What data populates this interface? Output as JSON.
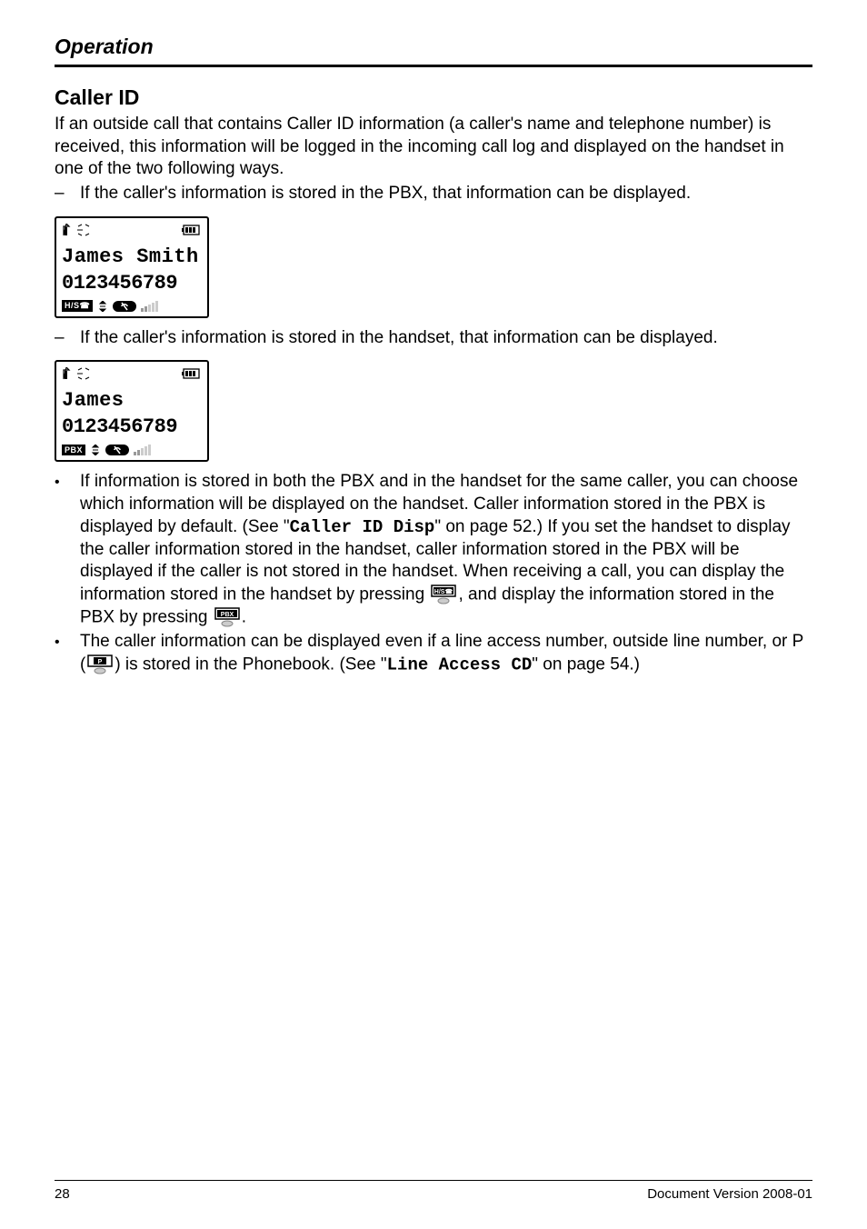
{
  "header": "Operation",
  "section_title": "Caller ID",
  "intro": "If an outside call that contains Caller ID information (a caller's name and telephone number) is received, this information will be logged in the incoming call log and displayed on the handset in one of the two following ways.",
  "dash1": "If the caller's information is stored in the PBX, that information can be displayed.",
  "display1": {
    "name": "James Smith",
    "number": "0123456789",
    "badge": "H/S"
  },
  "dash2": "If the caller's information is stored in the handset, that information can be displayed.",
  "display2": {
    "name": "James",
    "number": "0123456789",
    "badge": "PBX"
  },
  "bullet1_a": "If information is stored in both the PBX and in the handset for the same caller, you can choose which information will be displayed on the handset. Caller information stored in the PBX is displayed by default. (See \"",
  "bullet1_code1": "Caller ID Disp",
  "bullet1_b": "\" on page 52.) If you set the handset to display the caller information stored in the handset, caller information stored in the PBX will be displayed if the caller is not stored in the handset. When receiving a call, you can display the information stored in the handset by pressing ",
  "bullet1_c": ", and display the information stored in the PBX by pressing ",
  "bullet1_d": ".",
  "bullet2_a": "The caller information can be displayed even if a line access number, outside line number, or P (",
  "bullet2_b": ") is stored in the Phonebook. (See \"",
  "bullet2_code": "Line Access CD",
  "bullet2_c": "\" on page 54.)",
  "page_number": "28",
  "doc_version": "Document Version  2008-01"
}
